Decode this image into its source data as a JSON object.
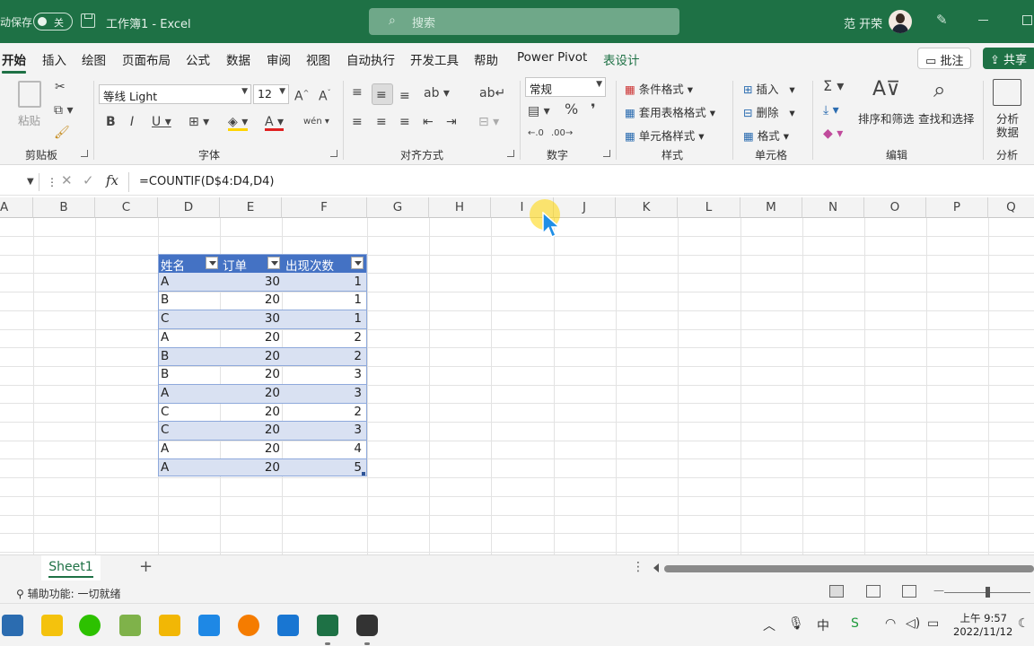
{
  "titlebar": {
    "autosave_label": "动保存",
    "autosave_state": "关",
    "doc_title": "工作簿1 - Excel",
    "search_placeholder": "搜索",
    "user_name": "范 开荣"
  },
  "menu": {
    "tabs": [
      "开始",
      "插入",
      "绘图",
      "页面布局",
      "公式",
      "数据",
      "审阅",
      "视图",
      "自动执行",
      "开发工具",
      "帮助",
      "Power Pivot",
      "表设计"
    ],
    "comment": "批注",
    "share": "共享"
  },
  "ribbon": {
    "paste": "粘贴",
    "font_name": "等线 Light",
    "font_size": "12",
    "number_format": "常规",
    "conditional_format": "条件格式",
    "format_as_table": "套用表格格式",
    "cell_styles": "单元格样式",
    "insert": "插入",
    "delete": "删除",
    "format": "格式",
    "sort_filter": "排序和筛选",
    "find_select": "查找和选择",
    "analyze1": "分析",
    "analyze2": "数据",
    "groups": {
      "clipboard": "剪贴板",
      "font": "字体",
      "alignment": "对齐方式",
      "number": "数字",
      "styles": "样式",
      "cells": "单元格",
      "editing": "编辑",
      "analysis": "分析"
    }
  },
  "formula_bar": {
    "fx": "fx",
    "formula": "=COUNTIF(D$4:D4,D4)"
  },
  "sheet": {
    "columns": [
      "A",
      "B",
      "C",
      "D",
      "E",
      "F",
      "G",
      "H",
      "I",
      "J",
      "K",
      "L",
      "M",
      "N",
      "O",
      "P",
      "Q"
    ],
    "table": {
      "headers": [
        "姓名",
        "订单",
        "出现次数"
      ],
      "rows": [
        [
          "A",
          "30",
          "1"
        ],
        [
          "B",
          "20",
          "1"
        ],
        [
          "C",
          "30",
          "1"
        ],
        [
          "A",
          "20",
          "2"
        ],
        [
          "B",
          "20",
          "2"
        ],
        [
          "B",
          "20",
          "3"
        ],
        [
          "A",
          "20",
          "3"
        ],
        [
          "C",
          "20",
          "2"
        ],
        [
          "C",
          "20",
          "3"
        ],
        [
          "A",
          "20",
          "4"
        ],
        [
          "A",
          "20",
          "5"
        ]
      ]
    }
  },
  "tabs_bar": {
    "sheet_name": "Sheet1",
    "add": "+"
  },
  "status": {
    "accessibility": "辅助功能: 一切就绪"
  },
  "taskbar": {
    "time": "上午 9:57",
    "date": "2022/11/12"
  },
  "colors": {
    "excel_green": "#1e7145",
    "table_header": "#4472c4",
    "table_band": "#d9e1f2"
  }
}
